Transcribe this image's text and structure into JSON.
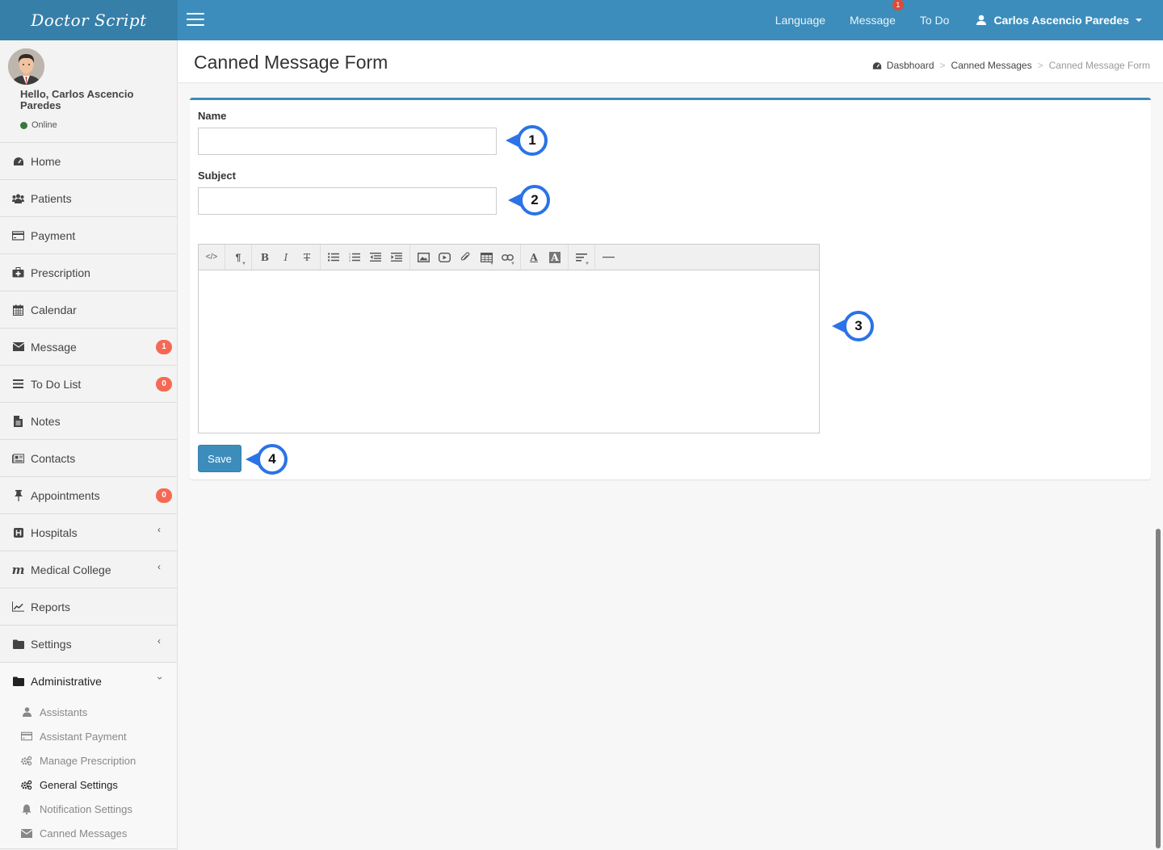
{
  "app": {
    "brand": "Doctor Script"
  },
  "topnav": {
    "language": "Language",
    "message": "Message",
    "message_badge": "1",
    "todo": "To Do",
    "user_name": "Carlos Ascencio Paredes"
  },
  "sidebar": {
    "greeting": "Hello, Carlos Ascencio Paredes",
    "status": "Online",
    "items": [
      {
        "label": "Home",
        "icon": "dashboard-icon"
      },
      {
        "label": "Patients",
        "icon": "users-icon"
      },
      {
        "label": "Payment",
        "icon": "credit-card-icon"
      },
      {
        "label": "Prescription",
        "icon": "medkit-icon"
      },
      {
        "label": "Calendar",
        "icon": "calendar-icon"
      },
      {
        "label": "Message",
        "icon": "envelope-icon",
        "badge": "1"
      },
      {
        "label": "To Do List",
        "icon": "list-icon",
        "badge": "0"
      },
      {
        "label": "Notes",
        "icon": "file-text-icon"
      },
      {
        "label": "Contacts",
        "icon": "newspaper-icon"
      },
      {
        "label": "Appointments",
        "icon": "thumbtack-icon",
        "badge": "0"
      },
      {
        "label": "Hospitals",
        "icon": "hospital-icon"
      },
      {
        "label": "Medical College",
        "icon": "maxcdn-icon"
      },
      {
        "label": "Reports",
        "icon": "line-chart-icon"
      },
      {
        "label": "Settings",
        "icon": "folder-icon"
      },
      {
        "label": "Administrative",
        "icon": "folder-icon"
      }
    ],
    "submenu": [
      {
        "label": "Assistants",
        "icon": "user-icon"
      },
      {
        "label": "Assistant Payment",
        "icon": "credit-card-icon"
      },
      {
        "label": "Manage Prescription",
        "icon": "cogs-icon"
      },
      {
        "label": "General Settings",
        "icon": "cogs-icon",
        "active": true
      },
      {
        "label": "Notification Settings",
        "icon": "bell-icon"
      },
      {
        "label": "Canned Messages",
        "icon": "envelope-icon"
      }
    ]
  },
  "page": {
    "title": "Canned Message Form",
    "breadcrumb": [
      "Dasbhoard",
      "Canned Messages",
      "Canned Message Form"
    ]
  },
  "form": {
    "name_label": "Name",
    "name_value": "",
    "subject_label": "Subject",
    "subject_value": "",
    "body_value": "",
    "save_label": "Save"
  },
  "editor_toolbar": {
    "code": "</>",
    "paragraph": "¶",
    "bold": "B",
    "italic": "I",
    "strike": "T",
    "font_color": "A",
    "back_color": "A"
  },
  "callouts": [
    "1",
    "2",
    "3",
    "4"
  ],
  "colors": {
    "primary": "#3c8dbc",
    "brand_bg": "#367fa9",
    "badge": "#f56954",
    "callout": "#2b73e6"
  }
}
